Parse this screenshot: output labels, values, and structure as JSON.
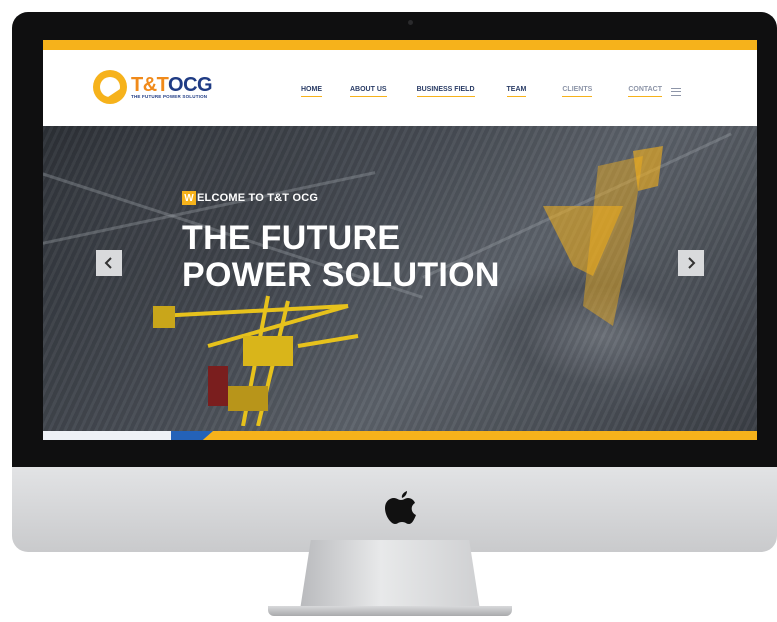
{
  "brand": {
    "name_part1": "T&T",
    "name_part2": "OCG",
    "tagline": "THE FUTURE POWER SOLUTION"
  },
  "nav": {
    "items": [
      {
        "label": "HOME",
        "color": "#2a3c66"
      },
      {
        "label": "ABOUT US",
        "color": "#2a3c66"
      },
      {
        "label": "BUSINESS FIELD",
        "color": "#2a3c66"
      },
      {
        "label": "TEAM",
        "color": "#2a3c66"
      },
      {
        "label": "CLIENTS",
        "color": "#8d95a8"
      },
      {
        "label": "CONTACT",
        "color": "#8d95a8"
      }
    ]
  },
  "hero": {
    "welcome_initial": "W",
    "welcome_rest": "ELCOME TO T&T OCG",
    "title_line1": "THE FUTURE",
    "title_line2": "POWER SOLUTION"
  },
  "icons": {
    "prev": "chevron-left-icon",
    "next": "chevron-right-icon",
    "menu": "hamburger-menu-icon",
    "apple": "apple-logo-icon"
  },
  "colors": {
    "accent": "#f6b21b",
    "brand_blue": "#1f3b84",
    "brand_orange": "#f08a1a",
    "band_blue": "#2462b8"
  }
}
